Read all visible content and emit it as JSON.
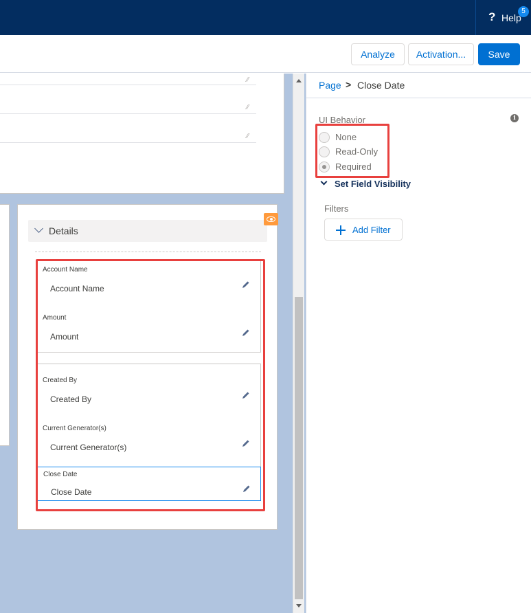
{
  "header": {
    "help_label": "Help",
    "help_badge": "5"
  },
  "toolbar": {
    "analyze_label": "Analyze",
    "activation_label": "Activation...",
    "save_label": "Save"
  },
  "details": {
    "section_label": "Details",
    "fields": [
      {
        "label": "Account Name",
        "value": "Account Name"
      },
      {
        "label": "Amount",
        "value": "Amount"
      },
      {
        "label": "Created By",
        "value": "Created By"
      },
      {
        "label": "Current Generator(s)",
        "value": "Current Generator(s)"
      },
      {
        "label": "Close Date",
        "value": "Close Date"
      }
    ]
  },
  "properties": {
    "breadcrumb": {
      "root": "Page",
      "separator": ">",
      "current": "Close Date"
    },
    "ui_behavior_label": "UI Behavior",
    "ui_behavior_options": [
      "None",
      "Read-Only",
      "Required"
    ],
    "ui_behavior_selected": "Required",
    "set_field_visibility_label": "Set Field Visibility",
    "filters_label": "Filters",
    "add_filter_label": "Add Filter"
  },
  "colors": {
    "header_bg": "#032d60",
    "brand_blue": "#0070d2",
    "canvas_bg": "#b0c4df",
    "highlight_red": "#e8403e",
    "visibility_badge": "#ff9a3c"
  }
}
